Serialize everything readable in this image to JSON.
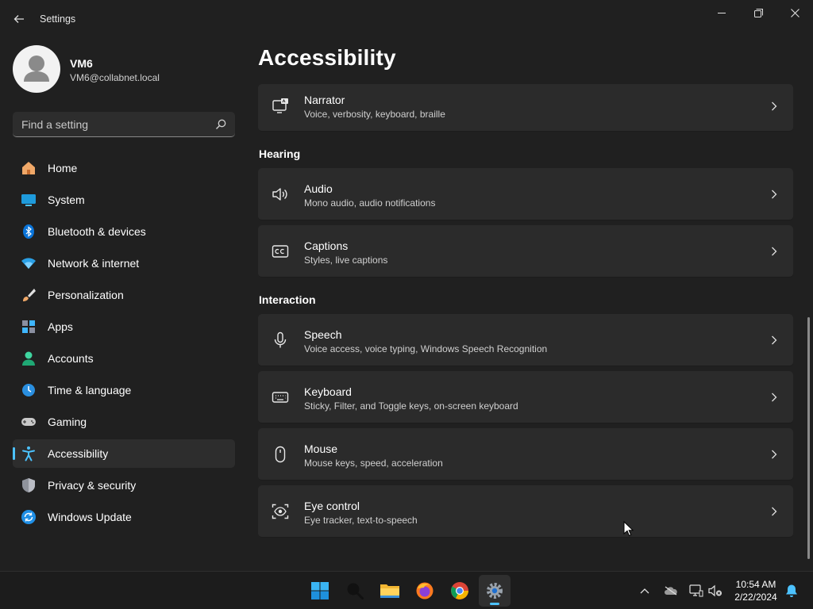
{
  "window": {
    "title": "Settings",
    "back_icon": "back-arrow-icon",
    "controls": [
      "minimize-icon",
      "restore-icon",
      "close-icon"
    ]
  },
  "profile": {
    "name": "VM6",
    "email": "VM6@collabnet.local"
  },
  "search": {
    "placeholder": "Find a setting",
    "icon": "search-icon"
  },
  "sidebar": {
    "items": [
      {
        "label": "Home",
        "icon": "home-icon"
      },
      {
        "label": "System",
        "icon": "system-icon"
      },
      {
        "label": "Bluetooth & devices",
        "icon": "bluetooth-icon"
      },
      {
        "label": "Network & internet",
        "icon": "network-icon"
      },
      {
        "label": "Personalization",
        "icon": "brush-icon"
      },
      {
        "label": "Apps",
        "icon": "apps-icon"
      },
      {
        "label": "Accounts",
        "icon": "accounts-icon"
      },
      {
        "label": "Time & language",
        "icon": "time-language-icon"
      },
      {
        "label": "Gaming",
        "icon": "gaming-icon"
      },
      {
        "label": "Accessibility",
        "icon": "accessibility-icon",
        "active": true
      },
      {
        "label": "Privacy & security",
        "icon": "shield-icon"
      },
      {
        "label": "Windows Update",
        "icon": "update-icon"
      }
    ]
  },
  "main": {
    "title": "Accessibility",
    "sections": {
      "hearing": "Hearing",
      "interaction": "Interaction"
    },
    "cards": {
      "narrator": {
        "title": "Narrator",
        "subtitle": "Voice, verbosity, keyboard, braille",
        "icon": "narrator-icon"
      },
      "audio": {
        "title": "Audio",
        "subtitle": "Mono audio, audio notifications",
        "icon": "speaker-icon"
      },
      "captions": {
        "title": "Captions",
        "subtitle": "Styles, live captions",
        "icon": "captions-icon"
      },
      "speech": {
        "title": "Speech",
        "subtitle": "Voice access, voice typing, Windows Speech Recognition",
        "icon": "microphone-icon"
      },
      "keyboard": {
        "title": "Keyboard",
        "subtitle": "Sticky, Filter, and Toggle keys, on-screen keyboard",
        "icon": "keyboard-icon"
      },
      "mouse": {
        "title": "Mouse",
        "subtitle": "Mouse keys, speed, acceleration",
        "icon": "mouse-icon"
      },
      "eye_control": {
        "title": "Eye control",
        "subtitle": "Eye tracker, text-to-speech",
        "icon": "eye-control-icon"
      }
    }
  },
  "taskbar": {
    "apps": [
      "start-icon",
      "search-icon",
      "file-explorer-icon",
      "firefox-icon",
      "chrome-icon",
      "settings-app-icon"
    ],
    "tray": [
      "chevron-up-icon",
      "onedrive-icon",
      "network-icon",
      "volume-muted-icon",
      "notification-bell-icon"
    ],
    "time": "10:54 AM",
    "date": "2/22/2024"
  },
  "colors": {
    "background": "#202020",
    "card": "#2b2b2b",
    "accent": "#4cc2ff",
    "taskbar": "#1c1c1c"
  }
}
